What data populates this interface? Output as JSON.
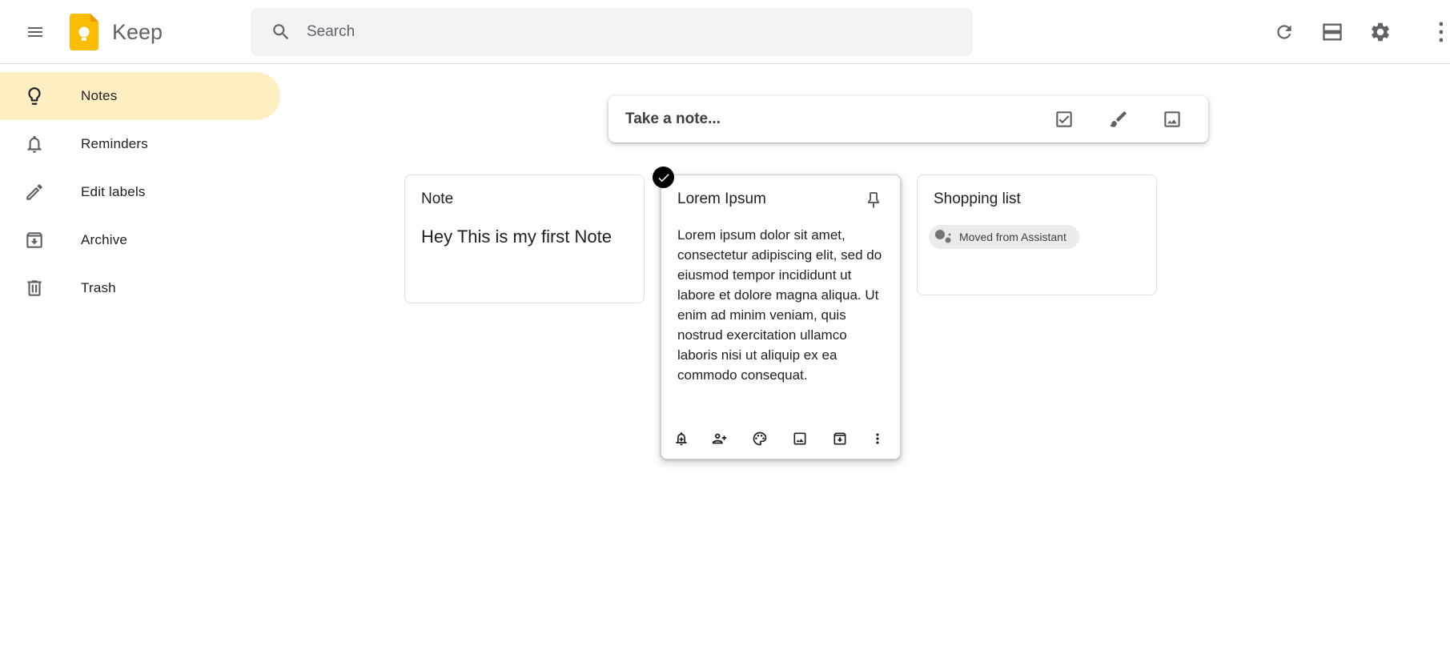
{
  "header": {
    "app_name": "Keep",
    "search_placeholder": "Search",
    "icons": [
      "main-menu-icon",
      "refresh-icon",
      "list-view-icon",
      "settings-icon",
      "more-icon"
    ]
  },
  "sidebar": {
    "items": [
      {
        "label": "Notes",
        "icon": "lightbulb-icon",
        "active": true
      },
      {
        "label": "Reminders",
        "icon": "bell-icon",
        "active": false
      },
      {
        "label": "Edit labels",
        "icon": "pencil-icon",
        "active": false
      },
      {
        "label": "Archive",
        "icon": "archive-icon",
        "active": false
      },
      {
        "label": "Trash",
        "icon": "trash-icon",
        "active": false
      }
    ]
  },
  "take_note": {
    "placeholder": "Take a note...",
    "icons": [
      "checkbox-icon",
      "brush-icon",
      "image-icon"
    ]
  },
  "notes": [
    {
      "title": "Note",
      "body": "Hey This is my first Note"
    },
    {
      "title": "Lorem Ipsum",
      "body": "Lorem ipsum dolor sit amet, consectetur adipiscing elit, sed do eiusmod tempor incididunt ut labore et dolore magna aliqua. Ut enim ad minim veniam, quis nostrud exercitation ullamco laboris nisi ut aliquip ex ea commodo consequat.",
      "selected": true,
      "toolbar": [
        "remind-icon",
        "collaborator-icon",
        "palette-icon",
        "image-icon",
        "archive-icon",
        "more-icon"
      ]
    },
    {
      "title": "Shopping list",
      "chip": "Moved from Assistant"
    }
  ],
  "colors": {
    "active_nav": "#feefc3",
    "logo_yellow": "#fbbc04",
    "search_bg": "#f1f3f4",
    "icon_gray": "#5f6368"
  }
}
